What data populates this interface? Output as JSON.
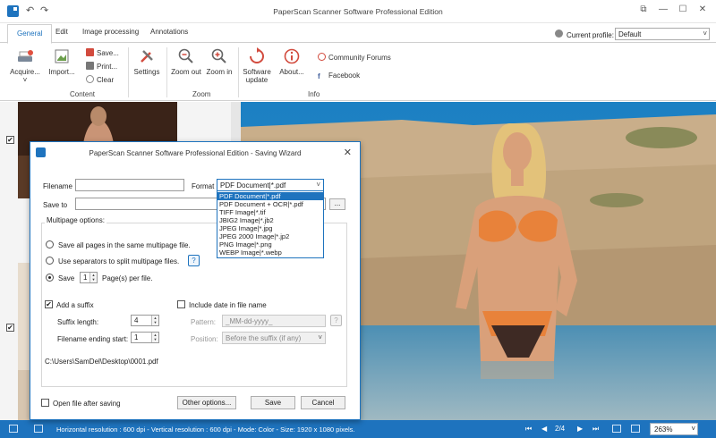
{
  "window": {
    "title": "PaperScan Scanner Software Professional Edition",
    "controls": {
      "help": "?",
      "restore": "⧉",
      "minimize": "—",
      "maximize": "☐",
      "close": "✕"
    },
    "undo": "↶",
    "redo": "↷"
  },
  "tabs": [
    {
      "label": "General",
      "active": true
    },
    {
      "label": "Edit"
    },
    {
      "label": "Image processing"
    },
    {
      "label": "Annotations"
    }
  ],
  "profile": {
    "label": "Current profile:",
    "value": "Default"
  },
  "ribbon": {
    "content": {
      "label": "Content",
      "acquire": "Acquire...",
      "acquire_arrow": "˅",
      "import": "Import...",
      "save": "Save...",
      "print": "Print...",
      "clear": "Clear",
      "settings": "Settings"
    },
    "zoom": {
      "label": "Zoom",
      "zoom_out": "Zoom out",
      "zoom_in": "Zoom in"
    },
    "info": {
      "label": "Info",
      "software_update_line1": "Software",
      "software_update_line2": "update",
      "about": "About...",
      "community": "Community Forums",
      "facebook": "Facebook"
    }
  },
  "thumbnails": [
    {
      "checked": true,
      "check_mark": "✔"
    },
    {
      "checked": true,
      "check_mark": "✔"
    }
  ],
  "status": {
    "text": "Horizontal resolution : 600 dpi - Vertical resolution : 600 dpi - Mode: Color - Size: 1920 x 1080 pixels.",
    "page": "2/4",
    "first": "⏮",
    "prev": "◀",
    "next": "▶",
    "last": "⏭",
    "zoom": "263%",
    "zoom_arrow": "˅"
  },
  "dialog": {
    "title": "PaperScan Scanner Software Professional Edition - Saving Wizard",
    "close": "✕",
    "filename_label": "Filename",
    "filename_value": "",
    "format_label": "Format",
    "format_value": "PDF Document|*.pdf",
    "format_arrow": "˅",
    "format_options": [
      {
        "label": "PDF Document|*.pdf",
        "selected": true
      },
      {
        "label": "PDF Document + OCR|*.pdf"
      },
      {
        "label": "TIFF Image|*.tif"
      },
      {
        "label": "JBIG2 Image|*.jb2"
      },
      {
        "label": "JPEG Image|*.jpg"
      },
      {
        "label": "JPEG 2000 Image|*.jp2"
      },
      {
        "label": "PNG Image|*.png"
      },
      {
        "label": "WEBP Image|*.webp"
      }
    ],
    "save_to_label": "Save to",
    "save_to_value": "",
    "browse": "...",
    "multipage_title": "Multipage options:",
    "opt_same_file": "Save all pages in the same multipage file.",
    "opt_separators": "Use separators to split multipage files.",
    "opt_save": "Save",
    "pages_value": "1",
    "pages_suffix": "Page(s) per file.",
    "help": "?",
    "add_suffix_label": "Add a suffix",
    "add_suffix_checked": true,
    "check_mark": "✔",
    "suffix_length_label": "Suffix length:",
    "suffix_length_value": "4",
    "ending_start_label": "Filename ending start:",
    "ending_start_value": "1",
    "spin_up": "▲",
    "spin_down": "▼",
    "include_date_label": "Include date in file name",
    "pattern_label": "Pattern:",
    "pattern_value": "_MM-dd-yyyy_",
    "position_label": "Position:",
    "position_value": "Before the suffix (if any)",
    "position_arrow": "˅",
    "path": "C:\\Users\\SamDel\\Desktop\\0001.pdf",
    "open_after_label": "Open file after saving",
    "other_options": "Other options...",
    "save_button": "Save",
    "cancel_button": "Cancel"
  },
  "colors": {
    "accent": "#1e73be",
    "sea": "#2f7fb0",
    "skin": "#d9a07a",
    "bikini": "#e8823a",
    "rock": "#c7ab86"
  }
}
